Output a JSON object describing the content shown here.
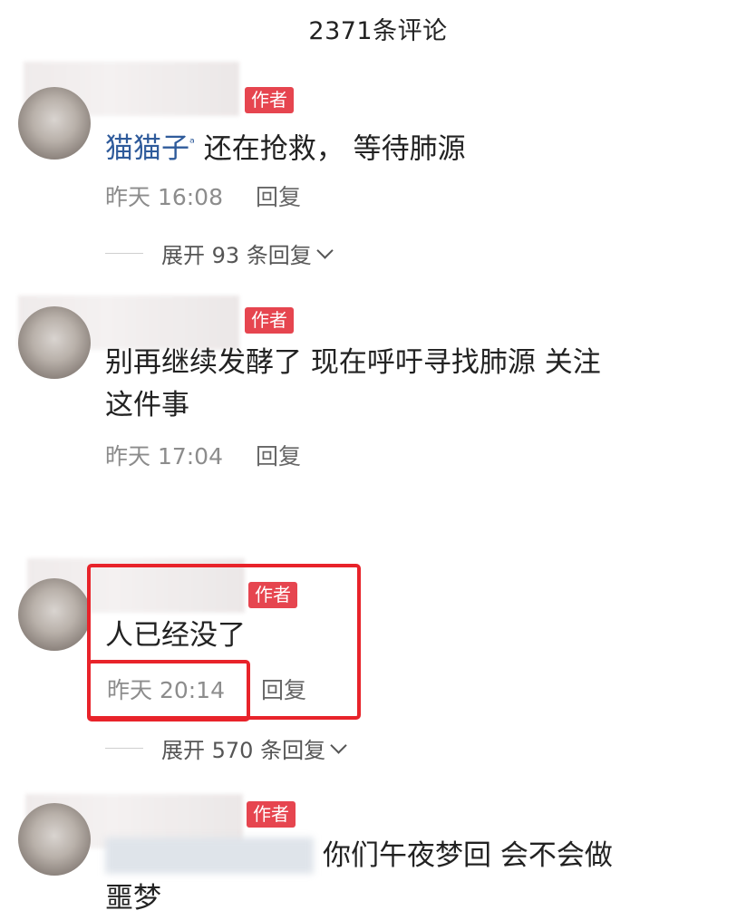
{
  "header": {
    "title": "2371条评论"
  },
  "comments": [
    {
      "badge": "作者",
      "nickname": "猫猫子",
      "nickname_icon": "ᵃ",
      "text": "还在抢救， 等待肺源",
      "time": "昨天 16:08",
      "reply": "回复",
      "expand": "展开 93 条回复"
    },
    {
      "badge": "作者",
      "text_line1": "别再继续发酵了 现在呼吁寻找肺源 关注",
      "text_line2": "这件事",
      "time": "昨天 17:04",
      "reply": "回复"
    },
    {
      "badge": "作者",
      "text": "人已经没了",
      "time": "昨天 20:14",
      "reply": "回复",
      "expand": "展开 570 条回复"
    },
    {
      "badge": "作者",
      "text_line1": "你们午夜梦回 会不会做",
      "text_line2": "噩梦"
    }
  ],
  "colors": {
    "badge": "#e6454f",
    "highlight": "#e8232a",
    "nickname": "#2f5b9b"
  }
}
